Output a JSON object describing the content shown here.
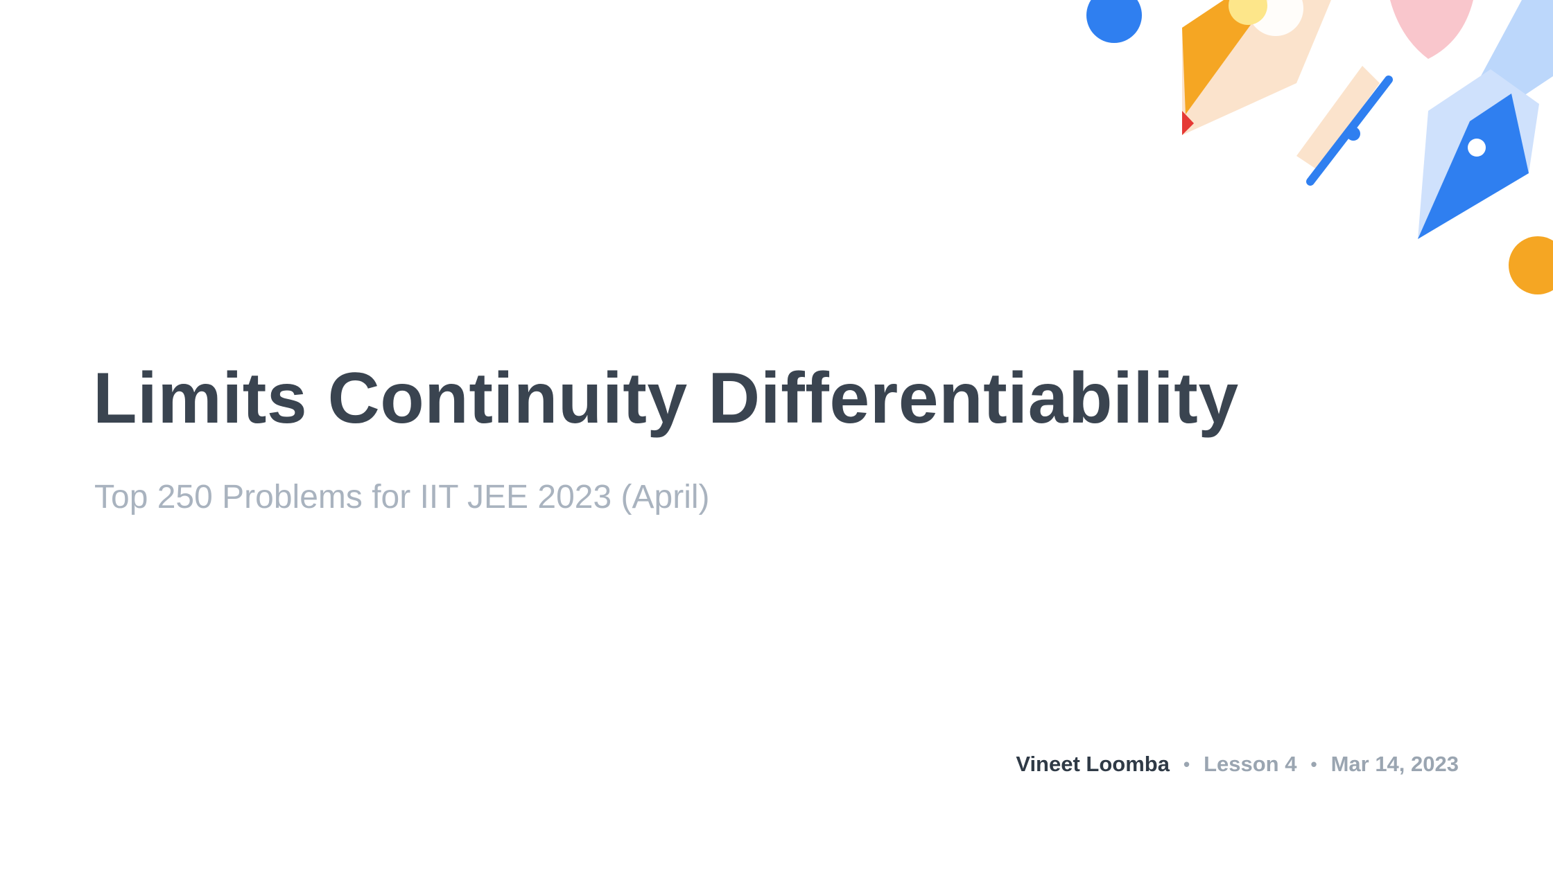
{
  "slide": {
    "title": "Limits Continuity Differentiability",
    "subtitle": "Top 250 Problems for IIT JEE 2023 (April)",
    "author": "Vineet Loomba",
    "lesson": "Lesson 4",
    "date": "Mar 14, 2023",
    "separator": "•"
  },
  "colors": {
    "title": "#3a4450",
    "subtitle": "#a9b3bf",
    "author": "#2f3a46",
    "muted": "#9aa5b1",
    "accent_blue": "#2f7ff0",
    "accent_orange": "#f5a623",
    "accent_pink": "#f7b8c0",
    "accent_yellow": "#fde68a",
    "accent_light_blue": "#bcd7fb",
    "accent_red": "#e53935"
  },
  "decoration_icons": [
    "pencil-icon",
    "fountain-pen-icon",
    "brush-icon",
    "blue-circle-icon",
    "orange-circle-icon",
    "pink-shape-icon"
  ]
}
